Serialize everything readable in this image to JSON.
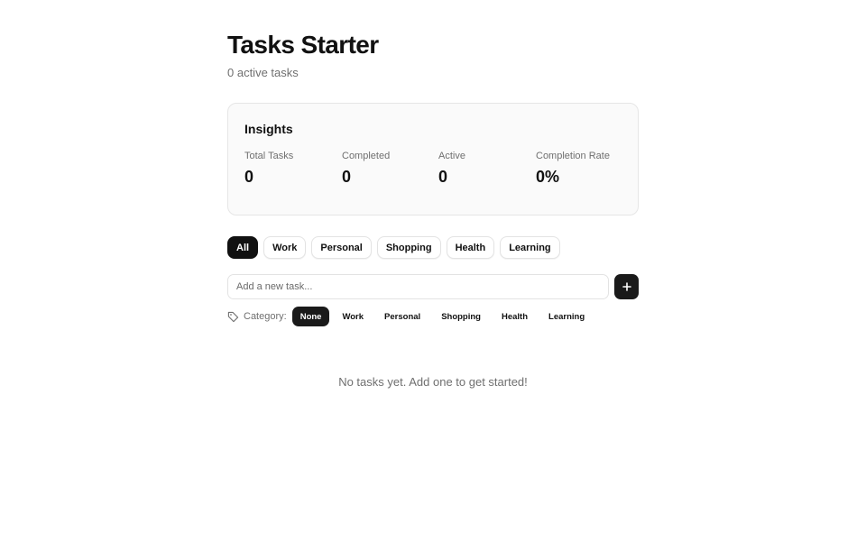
{
  "header": {
    "title": "Tasks Starter",
    "subtitle": "0 active tasks"
  },
  "insights": {
    "title": "Insights",
    "stats": [
      {
        "label": "Total Tasks",
        "value": "0"
      },
      {
        "label": "Completed",
        "value": "0"
      },
      {
        "label": "Active",
        "value": "0"
      },
      {
        "label": "Completion Rate",
        "value": "0%"
      }
    ]
  },
  "filters": {
    "selected": "All",
    "items": [
      "All",
      "Work",
      "Personal",
      "Shopping",
      "Health",
      "Learning"
    ]
  },
  "add_task": {
    "placeholder": "Add a new task...",
    "value": "",
    "button_icon": "plus-icon"
  },
  "category": {
    "label": "Category:",
    "icon": "tag-icon",
    "selected": "None",
    "options": [
      "None",
      "Work",
      "Personal",
      "Shopping",
      "Health",
      "Learning"
    ]
  },
  "empty_state": {
    "message": "No tasks yet. Add one to get started!"
  },
  "colors": {
    "accent": "#111111",
    "muted_text": "#6f6f6f",
    "card_background": "#fafafa",
    "border": "#e6e6e6"
  }
}
